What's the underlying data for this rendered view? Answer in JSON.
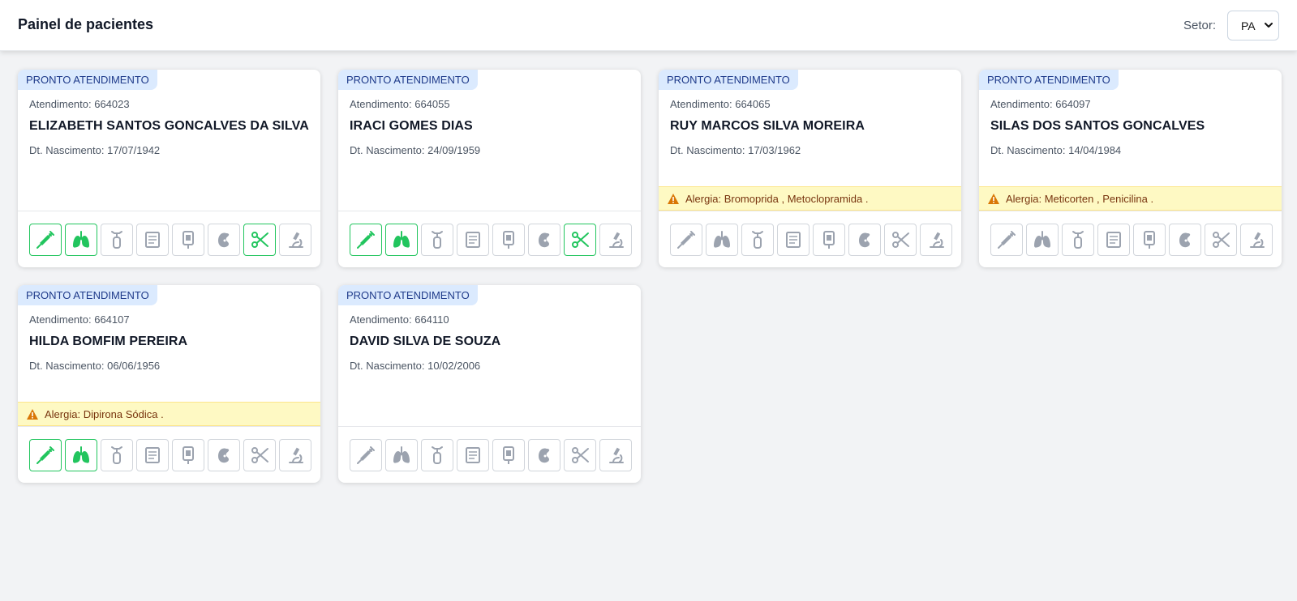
{
  "header": {
    "title": "Painel de pacientes",
    "sector_label": "Setor:",
    "sector_value": "PA"
  },
  "icon_names": [
    "syringe-icon",
    "lungs-icon",
    "oxygen-icon",
    "document-icon",
    "iv-bag-icon",
    "kidney-icon",
    "scissors-icon",
    "microscope-icon"
  ],
  "colors": {
    "active": "#22c55e",
    "inactive": "#9ca3af",
    "badge_bg": "#dbeafe",
    "badge_text": "#1e3a8a",
    "allergy_bg": "#fef9c3"
  },
  "patients": [
    {
      "badge": "PRONTO ATENDIMENTO",
      "attendance": "Atendimento: 664023",
      "name": "ELIZABETH SANTOS GONCALVES DA SILVA",
      "birth": "Dt. Nascimento: 17/07/1942",
      "allergy": "",
      "active": [
        true,
        true,
        false,
        false,
        false,
        false,
        true,
        false
      ]
    },
    {
      "badge": "PRONTO ATENDIMENTO",
      "attendance": "Atendimento: 664055",
      "name": "IRACI GOMES DIAS",
      "birth": "Dt. Nascimento: 24/09/1959",
      "allergy": "",
      "active": [
        true,
        true,
        false,
        false,
        false,
        false,
        true,
        false
      ]
    },
    {
      "badge": "PRONTO ATENDIMENTO",
      "attendance": "Atendimento: 664065",
      "name": "RUY MARCOS SILVA MOREIRA",
      "birth": "Dt. Nascimento: 17/03/1962",
      "allergy": "Alergia: Bromoprida , Metoclopramida .",
      "active": [
        false,
        false,
        false,
        false,
        false,
        false,
        false,
        false
      ]
    },
    {
      "badge": "PRONTO ATENDIMENTO",
      "attendance": "Atendimento: 664097",
      "name": "SILAS DOS SANTOS GONCALVES",
      "birth": "Dt. Nascimento: 14/04/1984",
      "allergy": "Alergia: Meticorten , Penicilina .",
      "active": [
        false,
        false,
        false,
        false,
        false,
        false,
        false,
        false
      ]
    },
    {
      "badge": "PRONTO ATENDIMENTO",
      "attendance": "Atendimento: 664107",
      "name": "HILDA BOMFIM PEREIRA",
      "birth": "Dt. Nascimento: 06/06/1956",
      "allergy": "Alergia: Dipirona Sódica .",
      "active": [
        true,
        true,
        false,
        false,
        false,
        false,
        false,
        false
      ]
    },
    {
      "badge": "PRONTO ATENDIMENTO",
      "attendance": "Atendimento: 664110",
      "name": "DAVID SILVA DE SOUZA",
      "birth": "Dt. Nascimento: 10/02/2006",
      "allergy": "",
      "active": [
        false,
        false,
        false,
        false,
        false,
        false,
        false,
        false
      ]
    }
  ]
}
